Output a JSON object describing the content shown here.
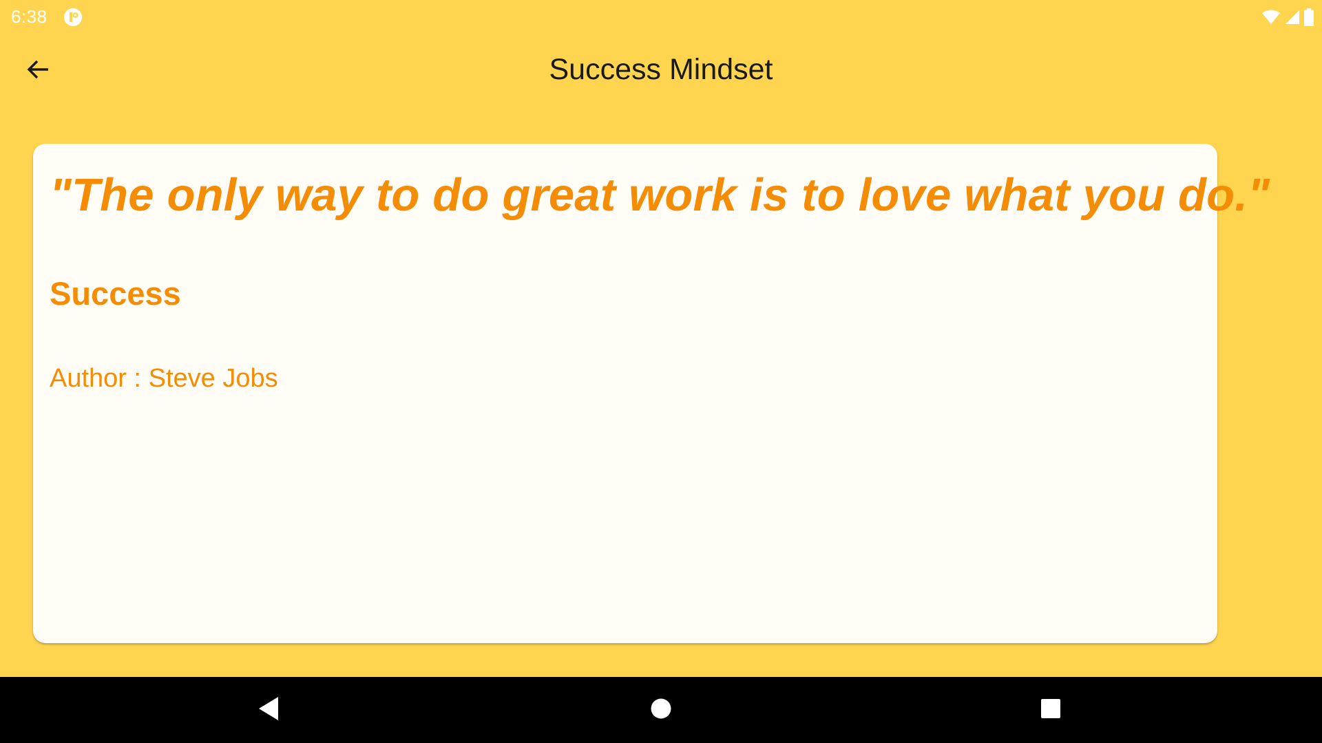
{
  "status_bar": {
    "time": "6:38",
    "icons": {
      "app": "notification-app-icon",
      "wifi": "wifi-icon",
      "signal": "cell-signal-icon",
      "battery": "battery-icon"
    }
  },
  "app_bar": {
    "title": "Success Mindset",
    "back_icon": "arrow-back-icon"
  },
  "quote_card": {
    "quote": "\"The only way to do great work is to love what you do.\"",
    "category": "Success",
    "author": "Author : Steve Jobs"
  },
  "nav_bar": {
    "icons": [
      "nav-back-icon",
      "nav-home-icon",
      "nav-recents-icon"
    ]
  },
  "colors": {
    "background": "#FFD54F",
    "card": "#FFFDF6",
    "accent_text": "#F48C06",
    "title_text": "#1A1A1A",
    "nav_bar": "#000000"
  }
}
